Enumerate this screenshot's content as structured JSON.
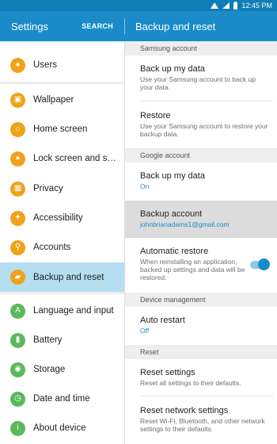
{
  "status": {
    "time": "12:45 PM"
  },
  "header": {
    "left_title": "Settings",
    "search_label": "SEARCH",
    "right_title": "Backup and reset"
  },
  "sidebar": {
    "items": [
      {
        "label": "Users",
        "icon": "users-icon"
      },
      {
        "label": "Wallpaper",
        "icon": "wallpaper-icon"
      },
      {
        "label": "Home screen",
        "icon": "home-icon"
      },
      {
        "label": "Lock screen and s…",
        "icon": "lock-icon"
      },
      {
        "label": "Privacy",
        "icon": "privacy-icon"
      },
      {
        "label": "Accessibility",
        "icon": "accessibility-icon"
      },
      {
        "label": "Accounts",
        "icon": "key-icon"
      },
      {
        "label": "Backup and reset",
        "icon": "backup-icon",
        "selected": true
      },
      {
        "label": "Language and input",
        "icon": "language-icon"
      },
      {
        "label": "Battery",
        "icon": "battery-icon"
      },
      {
        "label": "Storage",
        "icon": "storage-icon"
      },
      {
        "label": "Date and time",
        "icon": "clock-icon"
      },
      {
        "label": "About device",
        "icon": "info-icon"
      }
    ]
  },
  "sections": {
    "samsung": "Samsung account",
    "google": "Google account",
    "device": "Device management",
    "reset": "Reset"
  },
  "samsung": {
    "backup": {
      "title": "Back up my data",
      "sub": "Use your Samsung account to back up your data."
    },
    "restore": {
      "title": "Restore",
      "sub": "Use your Samsung account to restore your backup data."
    }
  },
  "google": {
    "backup": {
      "title": "Back up my data",
      "sub": "On"
    },
    "account": {
      "title": "Backup account",
      "sub": "johnbrianadams1@gmail.com"
    },
    "auto_restore": {
      "title": "Automatic restore",
      "sub": "When reinstalling an application, backed up settings and data will be restored.",
      "enabled": true
    }
  },
  "device": {
    "auto_restart": {
      "title": "Auto restart",
      "sub": "Off"
    }
  },
  "reset": {
    "settings": {
      "title": "Reset settings",
      "sub": "Reset all settings to their defaults."
    },
    "network": {
      "title": "Reset network settings",
      "sub": "Reset Wi-Fi, Bluetooth, and other network settings to their defaults."
    }
  },
  "colors": {
    "accent": "#1a8bc8",
    "statusbar": "#0f7db6",
    "icon_orange": "#f0a21b",
    "icon_green": "#5cb85c",
    "selected_bg": "#b5def0"
  }
}
